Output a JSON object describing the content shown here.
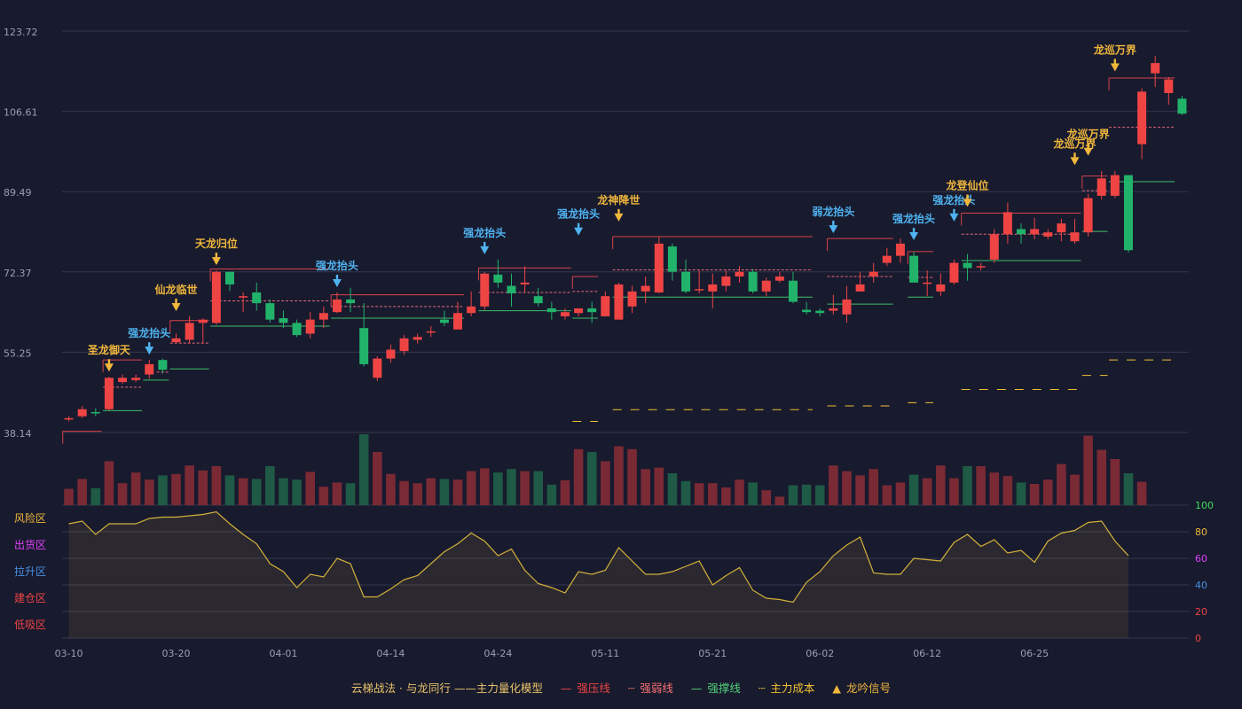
{
  "chart_data": {
    "type": "candlestick",
    "y_ticks": [
      "123.72",
      "106.61",
      "89.49",
      "72.37",
      "55.25",
      "38.14"
    ],
    "ylim": [
      38.14,
      123.72
    ],
    "x_ticks": [
      {
        "i": 0,
        "label": "03-10"
      },
      {
        "i": 8,
        "label": "03-20"
      },
      {
        "i": 16,
        "label": "04-01"
      },
      {
        "i": 24,
        "label": "04-14"
      },
      {
        "i": 32,
        "label": "04-24"
      },
      {
        "i": 40,
        "label": "05-11"
      },
      {
        "i": 48,
        "label": "05-21"
      },
      {
        "i": 56,
        "label": "06-02"
      },
      {
        "i": 64,
        "label": "06-12"
      },
      {
        "i": 72,
        "label": "06-25"
      }
    ],
    "candles": [
      [
        40.9,
        41.2,
        40.5,
        41.6
      ],
      [
        41.6,
        43.1,
        41.2,
        43.8
      ],
      [
        42.5,
        42.2,
        41.6,
        43.3
      ],
      [
        43.1,
        49.8,
        42.8,
        50.0
      ],
      [
        48.9,
        49.8,
        48.5,
        50.5
      ],
      [
        49.3,
        49.8,
        48.9,
        50.5
      ],
      [
        50.5,
        52.7,
        49.6,
        53.6
      ],
      [
        53.6,
        51.5,
        50.7,
        53.9
      ],
      [
        57.4,
        58.2,
        57.1,
        59.2
      ],
      [
        57.9,
        61.5,
        57.1,
        62.9
      ],
      [
        61.5,
        62.2,
        57.1,
        62.5
      ],
      [
        61.5,
        72.4,
        61.1,
        72.7
      ],
      [
        72.4,
        69.7,
        68.3,
        72.4
      ],
      [
        66.9,
        67.2,
        63.8,
        68.0
      ],
      [
        68.0,
        65.7,
        64.1,
        70.1
      ],
      [
        65.7,
        62.2,
        61.5,
        66.5
      ],
      [
        62.5,
        61.5,
        60.4,
        64.1
      ],
      [
        61.5,
        58.9,
        58.5,
        62.2
      ],
      [
        59.2,
        62.2,
        58.2,
        63.8
      ],
      [
        62.2,
        63.6,
        60.4,
        65.0
      ],
      [
        63.8,
        66.5,
        63.6,
        68.0
      ],
      [
        66.5,
        65.7,
        63.8,
        69.0
      ],
      [
        60.4,
        52.7,
        52.2,
        65.7
      ],
      [
        49.8,
        53.9,
        49.1,
        54.4
      ],
      [
        53.9,
        55.8,
        53.0,
        56.9
      ],
      [
        55.5,
        58.2,
        54.7,
        58.9
      ],
      [
        57.9,
        58.5,
        57.1,
        59.2
      ],
      [
        59.7,
        59.7,
        58.5,
        60.8
      ],
      [
        62.2,
        61.5,
        60.8,
        64.1
      ],
      [
        60.1,
        63.6,
        60.1,
        66.0
      ],
      [
        63.6,
        65.0,
        62.9,
        68.2
      ],
      [
        65.0,
        72.0,
        64.3,
        72.4
      ],
      [
        71.8,
        70.1,
        69.0,
        75.0
      ],
      [
        69.4,
        67.8,
        65.0,
        72.0
      ],
      [
        69.7,
        70.1,
        68.0,
        73.6
      ],
      [
        67.2,
        65.7,
        65.0,
        69.0
      ],
      [
        64.6,
        63.8,
        62.2,
        66.0
      ],
      [
        62.9,
        63.8,
        62.2,
        64.6
      ],
      [
        63.6,
        64.6,
        62.9,
        64.6
      ],
      [
        64.6,
        63.8,
        61.5,
        66.0
      ],
      [
        62.9,
        67.2,
        62.9,
        68.2
      ],
      [
        62.2,
        69.7,
        62.2,
        70.1
      ],
      [
        65.0,
        68.2,
        63.6,
        69.4
      ],
      [
        68.2,
        69.4,
        65.7,
        71.4
      ],
      [
        68.0,
        78.4,
        67.8,
        79.9
      ],
      [
        77.8,
        72.4,
        70.5,
        78.4
      ],
      [
        72.4,
        68.2,
        67.8,
        75.0
      ],
      [
        68.7,
        68.7,
        67.8,
        72.7
      ],
      [
        68.2,
        69.7,
        64.6,
        72.0
      ],
      [
        69.4,
        71.4,
        68.2,
        72.7
      ],
      [
        71.4,
        72.4,
        70.1,
        73.6
      ],
      [
        72.4,
        68.2,
        67.8,
        73.0
      ],
      [
        68.2,
        70.5,
        67.2,
        71.2
      ],
      [
        70.5,
        71.4,
        70.1,
        72.4
      ],
      [
        70.5,
        66.0,
        65.7,
        72.4
      ],
      [
        64.3,
        63.8,
        63.3,
        66.0
      ],
      [
        64.1,
        63.6,
        62.9,
        64.6
      ],
      [
        64.1,
        64.6,
        63.3,
        67.5
      ],
      [
        63.3,
        66.5,
        61.5,
        69.4
      ],
      [
        68.2,
        69.7,
        68.2,
        72.4
      ],
      [
        71.4,
        72.4,
        70.1,
        74.3
      ],
      [
        74.3,
        75.8,
        73.6,
        77.5
      ],
      [
        75.8,
        78.4,
        74.3,
        79.5
      ],
      [
        75.8,
        70.1,
        70.1,
        76.7
      ],
      [
        70.1,
        70.1,
        67.2,
        72.7
      ],
      [
        68.2,
        69.7,
        67.2,
        72.0
      ],
      [
        70.1,
        74.3,
        69.7,
        75.0
      ],
      [
        74.3,
        73.2,
        70.5,
        76.2
      ],
      [
        73.6,
        73.6,
        72.7,
        74.3
      ],
      [
        75.0,
        80.4,
        74.3,
        81.5
      ],
      [
        80.4,
        85.1,
        78.4,
        87.2
      ],
      [
        81.5,
        80.4,
        78.4,
        82.7
      ],
      [
        80.4,
        81.5,
        79.3,
        83.9
      ],
      [
        79.9,
        80.8,
        79.3,
        81.5
      ],
      [
        80.8,
        82.7,
        78.9,
        83.7
      ],
      [
        78.9,
        80.8,
        78.4,
        83.7
      ],
      [
        80.8,
        88.1,
        79.9,
        89.0
      ],
      [
        88.6,
        92.3,
        87.8,
        93.9
      ],
      [
        88.6,
        93.0,
        88.1,
        93.9
      ],
      [
        93.0,
        77.0,
        76.5,
        93.0
      ],
      [
        99.6,
        110.8,
        96.4,
        111.5
      ],
      [
        114.7,
        116.9,
        111.8,
        118.4
      ],
      [
        110.5,
        113.4,
        108.0,
        113.9
      ],
      [
        109.3,
        106.1,
        105.8,
        109.9
      ]
    ],
    "volume": [
      0.23,
      0.37,
      0.24,
      0.62,
      0.31,
      0.46,
      0.36,
      0.42,
      0.44,
      0.56,
      0.49,
      0.55,
      0.42,
      0.38,
      0.37,
      0.55,
      0.38,
      0.36,
      0.47,
      0.26,
      0.32,
      0.31,
      1.0,
      0.75,
      0.44,
      0.34,
      0.31,
      0.38,
      0.37,
      0.36,
      0.48,
      0.52,
      0.46,
      0.51,
      0.48,
      0.48,
      0.29,
      0.35,
      0.79,
      0.75,
      0.62,
      0.83,
      0.79,
      0.51,
      0.53,
      0.45,
      0.34,
      0.31,
      0.31,
      0.25,
      0.36,
      0.32,
      0.21,
      0.12,
      0.28,
      0.29,
      0.28,
      0.56,
      0.48,
      0.42,
      0.51,
      0.28,
      0.32,
      0.43,
      0.38,
      0.56,
      0.38,
      0.55,
      0.55,
      0.46,
      0.41,
      0.32,
      0.3,
      0.36,
      0.58,
      0.43,
      0.98,
      0.78,
      0.65,
      0.45,
      0.33
    ],
    "pressure_lines": [
      {
        "from": 0,
        "to": 2,
        "y": 38.4,
        "dash": false
      },
      {
        "from": 3,
        "to": 5,
        "y": 53.6,
        "dash": false
      },
      {
        "from": 8,
        "to": 10,
        "y": 62.0,
        "dash": false
      },
      {
        "from": 11,
        "to": 19,
        "y": 73.0,
        "dash": false
      },
      {
        "from": 20,
        "to": 29,
        "y": 67.5,
        "dash": false
      },
      {
        "from": 31,
        "to": 37,
        "y": 73.2,
        "dash": false
      },
      {
        "from": 38,
        "to": 39,
        "y": 71.4,
        "dash": false
      },
      {
        "from": 41,
        "to": 55,
        "y": 79.9,
        "dash": false
      },
      {
        "from": 57,
        "to": 61,
        "y": 79.5,
        "dash": false
      },
      {
        "from": 63,
        "to": 64,
        "y": 76.7,
        "dash": false
      },
      {
        "from": 67,
        "to": 75,
        "y": 84.9,
        "dash": false
      },
      {
        "from": 76,
        "to": 77,
        "y": 92.8,
        "dash": false
      },
      {
        "from": 78,
        "to": 82,
        "y": 113.7,
        "dash": false
      }
    ],
    "weak_lines": [
      {
        "from": 3,
        "to": 5,
        "y": 47.8
      },
      {
        "from": 7,
        "to": 7,
        "y": 51.0
      },
      {
        "from": 8,
        "to": 10,
        "y": 57.2
      },
      {
        "from": 11,
        "to": 19,
        "y": 66.2
      },
      {
        "from": 20,
        "to": 29,
        "y": 65.0
      },
      {
        "from": 31,
        "to": 37,
        "y": 68.0
      },
      {
        "from": 38,
        "to": 39,
        "y": 68.2
      },
      {
        "from": 41,
        "to": 55,
        "y": 72.8
      },
      {
        "from": 57,
        "to": 61,
        "y": 71.4
      },
      {
        "from": 63,
        "to": 64,
        "y": 71.2
      },
      {
        "from": 67,
        "to": 75,
        "y": 80.4
      },
      {
        "from": 76,
        "to": 77,
        "y": 89.7
      },
      {
        "from": 78,
        "to": 82,
        "y": 103.2
      }
    ],
    "support_lines": [
      {
        "from": 3,
        "to": 5,
        "y": 42.8
      },
      {
        "from": 6,
        "to": 7,
        "y": 49.3
      },
      {
        "from": 8,
        "to": 10,
        "y": 51.7
      },
      {
        "from": 11,
        "to": 19,
        "y": 60.8
      },
      {
        "from": 20,
        "to": 29,
        "y": 62.5
      },
      {
        "from": 31,
        "to": 37,
        "y": 64.1
      },
      {
        "from": 38,
        "to": 39,
        "y": 62.5
      },
      {
        "from": 41,
        "to": 55,
        "y": 67.0
      },
      {
        "from": 57,
        "to": 61,
        "y": 65.5
      },
      {
        "from": 63,
        "to": 64,
        "y": 67.0
      },
      {
        "from": 67,
        "to": 75,
        "y": 74.8
      },
      {
        "from": 76,
        "to": 77,
        "y": 81.0
      },
      {
        "from": 78,
        "to": 82,
        "y": 91.6
      }
    ],
    "cost_lines": [
      {
        "from": 38,
        "to": 39,
        "y": 40.5
      },
      {
        "from": 41,
        "to": 55,
        "y": 43.0
      },
      {
        "from": 57,
        "to": 61,
        "y": 43.8
      },
      {
        "from": 63,
        "to": 64,
        "y": 44.5
      },
      {
        "from": 67,
        "to": 75,
        "y": 47.3
      },
      {
        "from": 76,
        "to": 77,
        "y": 50.3
      },
      {
        "from": 78,
        "to": 82,
        "y": 53.6
      }
    ],
    "signals": [
      {
        "i": 3,
        "label": "圣龙御天",
        "above": 50.0,
        "color": "#f0b73c"
      },
      {
        "i": 6,
        "label": "强龙抬头",
        "above": 53.6,
        "color": "#4fb3f0"
      },
      {
        "i": 8,
        "label": "仙龙临世",
        "above": 62.9,
        "color": "#f0b73c"
      },
      {
        "i": 11,
        "label": "天龙归位",
        "above": 72.7,
        "color": "#f0b73c"
      },
      {
        "i": 20,
        "label": "强龙抬头",
        "above": 68.0,
        "color": "#4fb3f0"
      },
      {
        "i": 31,
        "label": "强龙抬头",
        "above": 75.0,
        "color": "#4fb3f0"
      },
      {
        "i": 38,
        "label": "强龙抬头",
        "above": 79.0,
        "color": "#4fb3f0"
      },
      {
        "i": 41,
        "label": "龙神降世",
        "above": 82.0,
        "color": "#f0b73c"
      },
      {
        "i": 57,
        "label": "弱龙抬头",
        "above": 79.5,
        "color": "#4fb3f0"
      },
      {
        "i": 63,
        "label": "强龙抬头",
        "above": 78.0,
        "color": "#4fb3f0"
      },
      {
        "i": 66,
        "label": "强龙抬头",
        "above": 82.0,
        "color": "#4fb3f0"
      },
      {
        "i": 67,
        "label": "龙登仙位",
        "above": 85.1,
        "color": "#f0b73c"
      },
      {
        "i": 75,
        "label": "龙巡万界",
        "above": 94.0,
        "color": "#f0b73c"
      },
      {
        "i": 76,
        "label": "龙巡万界",
        "above": 96.0,
        "color": "#f0b73c"
      },
      {
        "i": 78,
        "label": "龙巡万界",
        "above": 114.0,
        "color": "#f0b73c"
      }
    ],
    "oscillator": {
      "right_ticks": [
        "100",
        "80",
        "60",
        "40",
        "20",
        "0"
      ],
      "tick_colors": [
        "#3ddc5a",
        "#f0b73c",
        "#e040fb",
        "#4a90e2",
        "#ef4444",
        "#ef4444"
      ],
      "zones": [
        {
          "label": "风险区",
          "color": "#f0b73c"
        },
        {
          "label": "出货区",
          "color": "#e040fb"
        },
        {
          "label": "拉升区",
          "color": "#4a90e2"
        },
        {
          "label": "建仓区",
          "color": "#ef4444"
        },
        {
          "label": "低吸区",
          "color": "#ef4444"
        }
      ],
      "values": [
        86,
        88,
        78,
        86,
        86,
        86,
        90,
        91,
        91,
        92,
        93,
        95,
        86,
        78,
        71,
        56,
        50,
        38,
        48,
        46,
        60,
        56,
        31,
        31,
        37,
        44,
        47,
        56,
        65,
        71,
        79,
        73,
        62,
        67,
        51,
        41,
        38,
        34,
        50,
        48,
        51,
        68,
        58,
        48,
        48,
        50,
        54,
        58,
        40,
        47,
        53,
        36,
        30,
        29,
        27,
        42,
        50,
        62,
        70,
        76,
        49,
        48,
        48,
        60,
        59,
        58,
        72,
        78,
        69,
        74,
        64,
        66,
        57,
        73,
        79,
        81,
        87,
        88,
        73,
        62
      ]
    }
  },
  "legend": {
    "title": "云梯战法 · 与龙同行 ——主力量化模型",
    "items": [
      {
        "symbol": "—",
        "label": "强压线",
        "color": "#ef4444"
      },
      {
        "symbol": "┄",
        "label": "强弱线",
        "color": "#f87171"
      },
      {
        "symbol": "—",
        "label": "强撑线",
        "color": "#52d17a"
      },
      {
        "symbol": "┄",
        "label": "主力成本",
        "color": "#f0c030"
      },
      {
        "symbol": "▲",
        "label": "龙吟信号",
        "color": "#f0b73c"
      }
    ]
  },
  "colors": {
    "up": "#ef4444",
    "down": "#22b36b",
    "background": "#181a2e",
    "grid": "#34374f",
    "osc_line": "#d4b13a"
  }
}
